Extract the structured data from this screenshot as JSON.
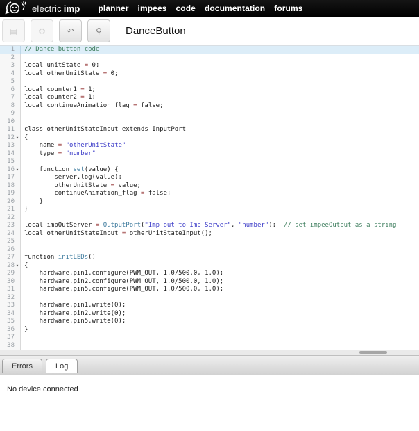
{
  "navbar": {
    "brand_electric": "electric",
    "brand_imp": "imp",
    "menu": [
      "planner",
      "impees",
      "code",
      "documentation",
      "forums"
    ]
  },
  "toolbar": {
    "title": "DanceButton",
    "buttons": [
      {
        "name": "save-button",
        "icon": "save-icon",
        "glyph": "▤",
        "enabled": false
      },
      {
        "name": "build-button",
        "icon": "gear-icon",
        "glyph": "⚙",
        "enabled": false
      },
      {
        "name": "revert-button",
        "icon": "undo-arrow-icon",
        "glyph": "↶",
        "enabled": true
      },
      {
        "name": "inspect-button",
        "icon": "magnifier-icon",
        "glyph": "⚲",
        "enabled": true
      }
    ]
  },
  "editor": {
    "active_line": 1,
    "fold_lines": [
      12,
      16,
      28
    ],
    "colors": {
      "active_line_bg": "#dcedf8",
      "comment": "#3f7f5f",
      "string": "#3c3cc8",
      "operator": "#8b2222",
      "function": "#3e7b9e"
    },
    "lines": [
      [
        [
          "c",
          "// Dance button code"
        ]
      ],
      [],
      [
        [
          "p",
          "local unitState "
        ],
        [
          "o",
          "="
        ],
        [
          "p",
          " 0;"
        ]
      ],
      [
        [
          "p",
          "local otherUnitState "
        ],
        [
          "o",
          "="
        ],
        [
          "p",
          " 0;"
        ]
      ],
      [],
      [
        [
          "p",
          "local counter1 "
        ],
        [
          "o",
          "="
        ],
        [
          "p",
          " 1;"
        ]
      ],
      [
        [
          "p",
          "local counter2 "
        ],
        [
          "o",
          "="
        ],
        [
          "p",
          " 1;"
        ]
      ],
      [
        [
          "p",
          "local continueAnimation_flag "
        ],
        [
          "o",
          "="
        ],
        [
          "p",
          " false;"
        ]
      ],
      [],
      [],
      [
        [
          "p",
          "class otherUnitStateInput extends InputPort"
        ]
      ],
      [
        [
          "p",
          "{"
        ]
      ],
      [
        [
          "p",
          "    name "
        ],
        [
          "o",
          "="
        ],
        [
          "p",
          " "
        ],
        [
          "s",
          "\"otherUnitState\""
        ]
      ],
      [
        [
          "p",
          "    type "
        ],
        [
          "o",
          "="
        ],
        [
          "p",
          " "
        ],
        [
          "s",
          "\"number\""
        ]
      ],
      [],
      [
        [
          "p",
          "    function "
        ],
        [
          "f",
          "set"
        ],
        [
          "p",
          "(value) {"
        ]
      ],
      [
        [
          "p",
          "        server.log(value);"
        ]
      ],
      [
        [
          "p",
          "        otherUnitState "
        ],
        [
          "o",
          "="
        ],
        [
          "p",
          " value;"
        ]
      ],
      [
        [
          "p",
          "        continueAnimation_flag "
        ],
        [
          "o",
          "="
        ],
        [
          "p",
          " false;"
        ]
      ],
      [
        [
          "p",
          "    }"
        ]
      ],
      [
        [
          "p",
          "}"
        ]
      ],
      [],
      [
        [
          "p",
          "local impOutServer "
        ],
        [
          "o",
          "="
        ],
        [
          "p",
          " "
        ],
        [
          "f",
          "OutputPort"
        ],
        [
          "p",
          "("
        ],
        [
          "s",
          "\"Imp out to Imp Server\""
        ],
        [
          "p",
          ", "
        ],
        [
          "s",
          "\"number\""
        ],
        [
          "p",
          ");  "
        ],
        [
          "c",
          "// set impeeOutput as a string"
        ]
      ],
      [
        [
          "p",
          "local otherUnitStateInput "
        ],
        [
          "o",
          "="
        ],
        [
          "p",
          " otherUnitStateInput();"
        ]
      ],
      [],
      [],
      [
        [
          "p",
          "function "
        ],
        [
          "f",
          "initLEDs"
        ],
        [
          "p",
          "()"
        ]
      ],
      [
        [
          "p",
          "{"
        ]
      ],
      [
        [
          "p",
          "    hardware.pin1.configure(PWM_OUT, 1.0/500.0, 1.0);"
        ]
      ],
      [
        [
          "p",
          "    hardware.pin2.configure(PWM_OUT, 1.0/500.0, 1.0);"
        ]
      ],
      [
        [
          "p",
          "    hardware.pin5.configure(PWM_OUT, 1.0/500.0, 1.0);"
        ]
      ],
      [],
      [
        [
          "p",
          "    hardware.pin1.write(0);"
        ]
      ],
      [
        [
          "p",
          "    hardware.pin2.write(0);"
        ]
      ],
      [
        [
          "p",
          "    hardware.pin5.write(0);"
        ]
      ],
      [
        [
          "p",
          "}"
        ]
      ],
      [],
      []
    ]
  },
  "tabs": [
    {
      "label": "Errors",
      "active": false
    },
    {
      "label": "Log",
      "active": true
    }
  ],
  "log": {
    "message": "No device connected"
  }
}
